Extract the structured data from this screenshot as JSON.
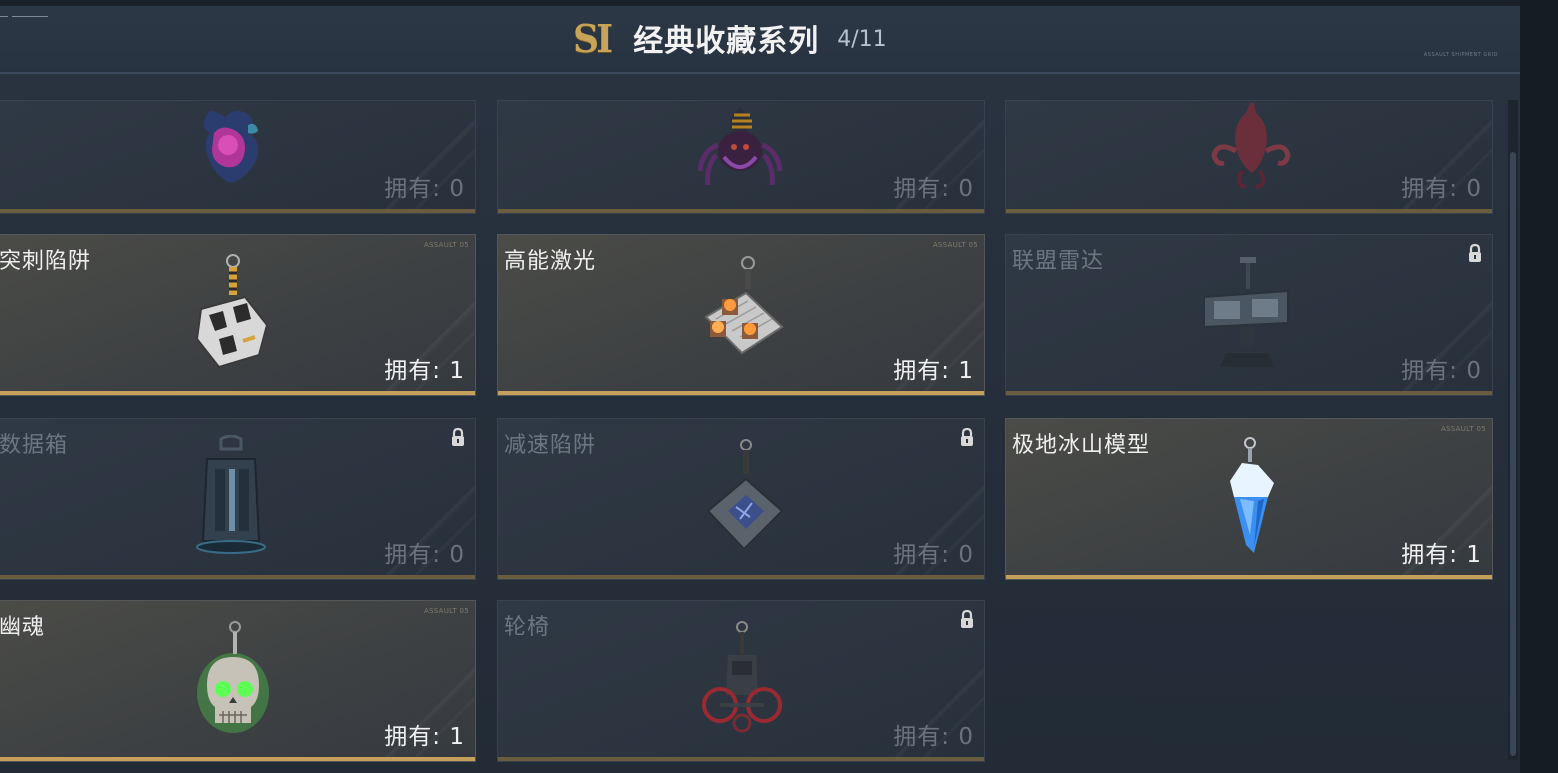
{
  "header": {
    "season_badge": "SI",
    "title": "经典收藏系列",
    "count": "4/11",
    "small_text": "ASSAULT SHIPMENT GRID"
  },
  "colors": {
    "gold": "#c4a05a",
    "owned_text": "#f0f0f0",
    "locked_text": "#6a737f",
    "panel": "#26303c"
  },
  "cards": [
    {
      "name": "",
      "owned_label": "拥有: 0",
      "owned": false,
      "locked": false,
      "icon": "purple-creature-charm-icon"
    },
    {
      "name": "",
      "owned_label": "拥有: 0",
      "owned": false,
      "locked": false,
      "icon": "spider-creature-charm-icon"
    },
    {
      "name": "",
      "owned_label": "拥有: 0",
      "owned": false,
      "locked": false,
      "icon": "tentacle-creature-charm-icon"
    },
    {
      "name": "突刺陷阱",
      "owned_label": "拥有: 1",
      "owned": true,
      "locked": false,
      "code": "ASSAULT 05",
      "icon": "spike-trap-charm-icon"
    },
    {
      "name": "高能激光",
      "owned_label": "拥有: 1",
      "owned": true,
      "locked": false,
      "code": "ASSAULT 05",
      "icon": "laser-charm-icon"
    },
    {
      "name": "联盟雷达",
      "owned_label": "拥有: 0",
      "owned": false,
      "locked": true,
      "icon": "radar-charm-icon"
    },
    {
      "name": "数据箱",
      "owned_label": "拥有: 0",
      "owned": false,
      "locked": true,
      "icon": "data-box-charm-icon"
    },
    {
      "name": "减速陷阱",
      "owned_label": "拥有: 0",
      "owned": false,
      "locked": true,
      "icon": "slow-trap-charm-icon"
    },
    {
      "name": "极地冰山模型",
      "owned_label": "拥有: 1",
      "owned": true,
      "locked": false,
      "code": "ASSAULT 05",
      "icon": "iceberg-charm-icon"
    },
    {
      "name": "幽魂",
      "owned_label": "拥有: 1",
      "owned": true,
      "locked": false,
      "code": "ASSAULT 05",
      "icon": "skull-ghost-charm-icon"
    },
    {
      "name": "轮椅",
      "owned_label": "拥有: 0",
      "owned": false,
      "locked": true,
      "icon": "wheelchair-charm-icon"
    }
  ]
}
